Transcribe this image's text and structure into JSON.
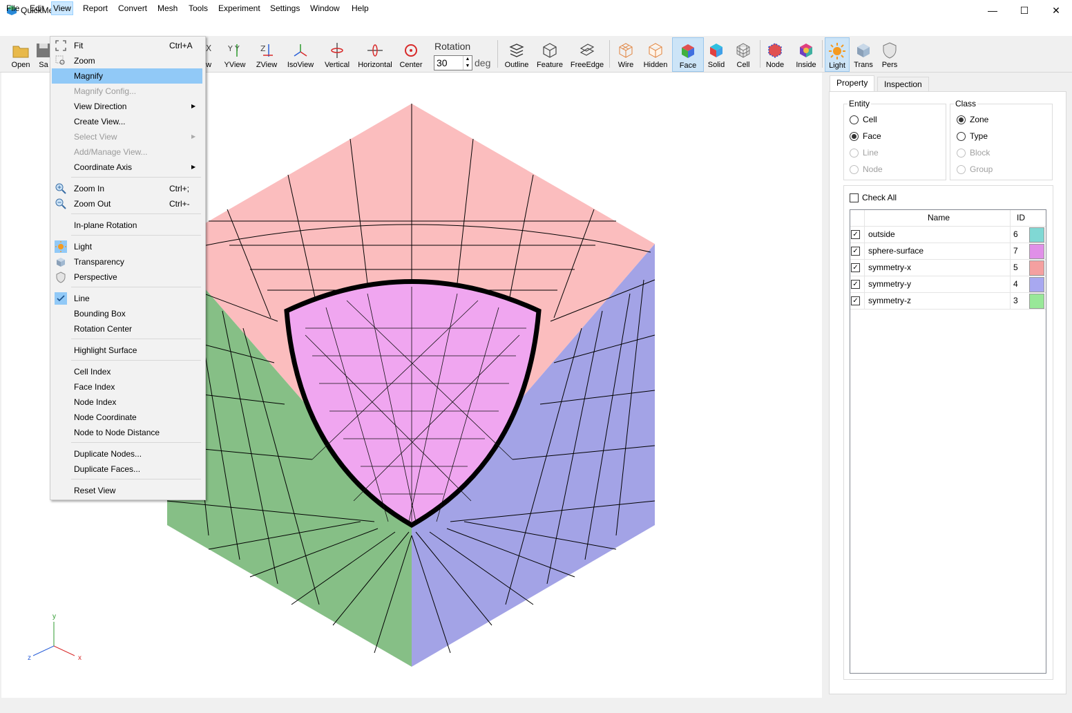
{
  "app": {
    "title": "QuickMesh",
    "minimize": "—",
    "maximize": "☐",
    "close": "✕"
  },
  "menubar": [
    "File",
    "Edit",
    "View",
    "Report",
    "Convert",
    "Mesh",
    "Tools",
    "Experiment",
    "Settings",
    "Window",
    "Help"
  ],
  "toolbar": {
    "open": "Open",
    "save": "Sa",
    "xview": "ew",
    "yview": "YView",
    "zview": "ZView",
    "isoview": "IsoView",
    "vertical": "Vertical",
    "horizontal": "Horizontal",
    "center": "Center",
    "rotation_label": "Rotation",
    "rotation_value": "30",
    "rotation_unit": "deg",
    "outline": "Outline",
    "feature": "Feature",
    "freeedge": "FreeEdge",
    "wire": "Wire",
    "hidden": "Hidden",
    "face": "Face",
    "solid": "Solid",
    "cell": "Cell",
    "node": "Node",
    "inside": "Inside",
    "light": "Light",
    "trans": "Trans",
    "pers": "Pers"
  },
  "view_menu": {
    "fit": "Fit",
    "fit_sc": "Ctrl+A",
    "zoom": "Zoom",
    "magnify": "Magnify",
    "magnify_config": "Magnify Config...",
    "view_direction": "View Direction",
    "create_view": "Create View...",
    "select_view": "Select View",
    "add_manage_view": "Add/Manage View...",
    "coordinate_axis": "Coordinate Axis",
    "zoom_in": "Zoom In",
    "zoom_in_sc": "Ctrl+;",
    "zoom_out": "Zoom Out",
    "zoom_out_sc": "Ctrl+-",
    "inplane_rotation": "In-plane Rotation",
    "light": "Light",
    "transparency": "Transparency",
    "perspective": "Perspective",
    "line": "Line",
    "bounding_box": "Bounding Box",
    "rotation_center": "Rotation Center",
    "highlight_surface": "Highlight Surface",
    "cell_index": "Cell Index",
    "face_index": "Face Index",
    "node_index": "Node Index",
    "node_coordinate": "Node Coordinate",
    "node_distance": "Node to Node Distance",
    "duplicate_nodes": "Duplicate Nodes...",
    "duplicate_faces": "Duplicate Faces...",
    "reset_view": "Reset View"
  },
  "tabs": {
    "property": "Property",
    "inspection": "Inspection"
  },
  "entity": {
    "title": "Entity",
    "cell": "Cell",
    "face": "Face",
    "line": "Line",
    "node": "Node",
    "selected": "Face"
  },
  "class": {
    "title": "Class",
    "zone": "Zone",
    "type": "Type",
    "block": "Block",
    "group": "Group",
    "selected": "Zone"
  },
  "check_all": "Check All",
  "table": {
    "headers": {
      "name": "Name",
      "id": "ID"
    },
    "rows": [
      {
        "name": "outside",
        "id": "6",
        "color": "#80d8d4",
        "checked": true
      },
      {
        "name": "sphere-surface",
        "id": "7",
        "color": "#e090e8",
        "checked": true
      },
      {
        "name": "symmetry-x",
        "id": "5",
        "color": "#f4a0a0",
        "checked": true
      },
      {
        "name": "symmetry-y",
        "id": "4",
        "color": "#a8a8f0",
        "checked": true
      },
      {
        "name": "symmetry-z",
        "id": "3",
        "color": "#98e898",
        "checked": true
      }
    ]
  },
  "axes": {
    "y": "y",
    "z": "z",
    "x": "x"
  },
  "colors": {
    "top_face": "#fbbdbe",
    "left_face": "#86bf86",
    "right_face": "#a3a3e6",
    "sphere": "#f0a6f0",
    "accent": "#91c9f7"
  }
}
